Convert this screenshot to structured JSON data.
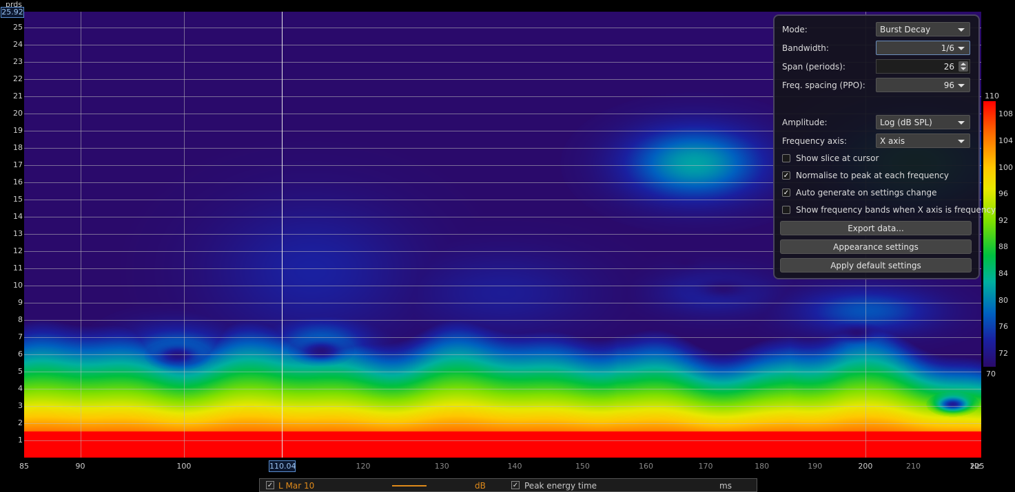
{
  "plot": {
    "y_unit": "prds",
    "y_cursor_value": "25.92",
    "y_ticks": [
      "25",
      "24",
      "23",
      "22",
      "21",
      "20",
      "19",
      "18",
      "17",
      "16",
      "15",
      "14",
      "13",
      "12",
      "11",
      "10",
      "9",
      "8",
      "7",
      "6",
      "5",
      "4",
      "3",
      "2",
      "1"
    ],
    "x_cursor_value": "110.04",
    "x_unit": "Hz",
    "x_ticks": [
      {
        "label": "85",
        "dim": false
      },
      {
        "label": "90",
        "dim": false
      },
      {
        "label": "100",
        "dim": false
      },
      {
        "label": "120",
        "dim": true
      },
      {
        "label": "130",
        "dim": true
      },
      {
        "label": "140",
        "dim": true
      },
      {
        "label": "150",
        "dim": true
      },
      {
        "label": "160",
        "dim": true
      },
      {
        "label": "170",
        "dim": true
      },
      {
        "label": "180",
        "dim": true
      },
      {
        "label": "190",
        "dim": true
      },
      {
        "label": "200",
        "dim": false
      },
      {
        "label": "210",
        "dim": true
      },
      {
        "label": "225",
        "dim": false
      }
    ]
  },
  "colorbar": {
    "max": "110",
    "min": "70",
    "ticks": [
      "108",
      "104",
      "100",
      "96",
      "92",
      "88",
      "84",
      "80",
      "76",
      "72"
    ]
  },
  "panel": {
    "mode_label": "Mode:",
    "mode_value": "Burst Decay",
    "bandwidth_label": "Bandwidth:",
    "bandwidth_value": "1/6",
    "span_label": "Span (periods):",
    "span_value": "26",
    "freq_spacing_label": "Freq. spacing (PPO):",
    "freq_spacing_value": "96",
    "amplitude_label": "Amplitude:",
    "amplitude_value": "Log (dB SPL)",
    "freq_axis_label": "Frequency axis:",
    "freq_axis_value": "X axis",
    "checks": [
      {
        "label": "Show slice at cursor",
        "checked": false
      },
      {
        "label": "Normalise to peak at each frequency",
        "checked": true
      },
      {
        "label": "Auto generate on settings change",
        "checked": true
      },
      {
        "label": "Show frequency bands when X axis is frequency",
        "checked": false
      }
    ],
    "export_button": "Export data...",
    "appearance_button": "Appearance settings",
    "defaults_button": "Apply default settings"
  },
  "legend": {
    "series_name": "L Mar 10",
    "series_unit": "dB",
    "series_color": "#e08a1a",
    "peak_label": "Peak energy time",
    "peak_unit": "ms"
  }
}
